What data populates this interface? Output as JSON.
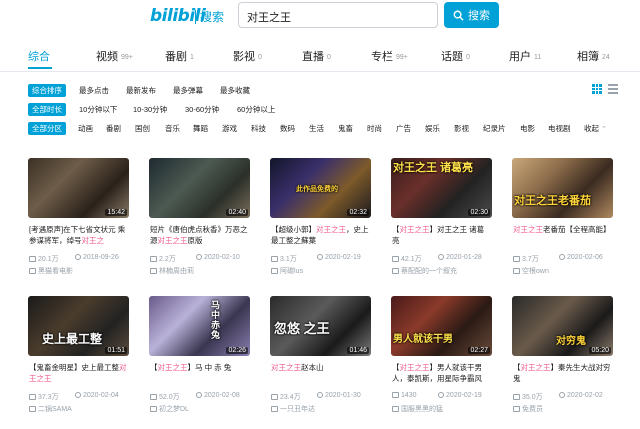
{
  "header": {
    "logo": "bilibili",
    "logo_suffix": "搜索",
    "search_value": "对王之王",
    "search_button": "搜索"
  },
  "tabs": [
    {
      "label": "综合",
      "count": ""
    },
    {
      "label": "视频",
      "count": "99+"
    },
    {
      "label": "番剧",
      "count": "1"
    },
    {
      "label": "影视",
      "count": "0"
    },
    {
      "label": "直播",
      "count": "0"
    },
    {
      "label": "专栏",
      "count": "99+"
    },
    {
      "label": "话题",
      "count": "0"
    },
    {
      "label": "用户",
      "count": "11"
    },
    {
      "label": "相簿",
      "count": "24"
    }
  ],
  "filters": {
    "sort": [
      "综合排序",
      "最多点击",
      "最新发布",
      "最多弹幕",
      "最多收藏"
    ],
    "duration": [
      "全部时长",
      "10分钟以下",
      "10-30分钟",
      "30-60分钟",
      "60分钟以上"
    ],
    "zone": [
      "全部分区",
      "动画",
      "番剧",
      "国创",
      "音乐",
      "舞蹈",
      "游戏",
      "科技",
      "数码",
      "生活",
      "鬼畜",
      "时尚",
      "广告",
      "娱乐",
      "影视",
      "纪录片",
      "电影",
      "电视剧"
    ],
    "collapse": "收起"
  },
  "videos": [
    {
      "pre": "[考遇原声]在下七省文状元 乘参谋将军，绰号",
      "hl": "对王之",
      "post": "",
      "duration": "15:42",
      "views": "20.1万",
      "date": "2018-09-26",
      "uploader": "黑猫看电影",
      "overlay": ""
    },
    {
      "pre": "短片《唐伯虎点秋香》万恶之源",
      "hl": "对王之王",
      "post": "原版",
      "duration": "02:40",
      "views": "2.2万",
      "date": "2020-02-10",
      "uploader": "林楠周由莉",
      "overlay": ""
    },
    {
      "pre": "【超级小郭】",
      "hl": "对王之王",
      "post": "，史上最工整之蘇葉",
      "duration": "02:32",
      "views": "3.1万",
      "date": "2020-02-19",
      "uploader": "阿碳lus",
      "overlay": "此作品免费的"
    },
    {
      "pre": "【",
      "hl": "对王之王",
      "post": "】对王之王 诸葛亮",
      "duration": "02:30",
      "views": "42.1万",
      "date": "2020-01-28",
      "uploader": "蔡配配的一个叙充",
      "overlay": "对王之王 诸葛亮"
    },
    {
      "pre": "",
      "hl": "对王之王",
      "post": "老番茄【全程高能】",
      "duration": "",
      "views": "3.7万",
      "date": "2020-02-06",
      "uploader": "空根own",
      "overlay": "对王之王老番茄"
    },
    {
      "pre": "【鬼畜金明星】史上最工整",
      "hl": "对王之王",
      "post": "",
      "duration": "01:51",
      "views": "37.3万",
      "date": "2020-02-04",
      "uploader": "二锅SAMA",
      "overlay": "史上最工整"
    },
    {
      "pre": "【",
      "hl": "对王之王",
      "post": "】马 中 赤 兔",
      "duration": "02:26",
      "views": "52.0万",
      "date": "2020-02-08",
      "uploader": "初之梦DL",
      "overlay": "马中赤兔"
    },
    {
      "pre": "",
      "hl": "对王之王",
      "post": "赵本山",
      "duration": "01:46",
      "views": "23.4万",
      "date": "2020-01-30",
      "uploader": "一只丑年达",
      "overlay": "忽悠 之王"
    },
    {
      "pre": "【",
      "hl": "对王之王",
      "post": "】男人就该干男人，泰凯斯，用星际争霸风",
      "duration": "02:27",
      "views": "1430",
      "date": "2020-02-19",
      "uploader": "国服黑黑的猛",
      "overlay": "男人就该干男"
    },
    {
      "pre": "【",
      "hl": "对王之王",
      "post": "】秦先生大战对穷鬼",
      "duration": "05:20",
      "views": "35.0万",
      "date": "2020-02-02",
      "uploader": "免费员",
      "overlay": "对穷鬼"
    }
  ]
}
